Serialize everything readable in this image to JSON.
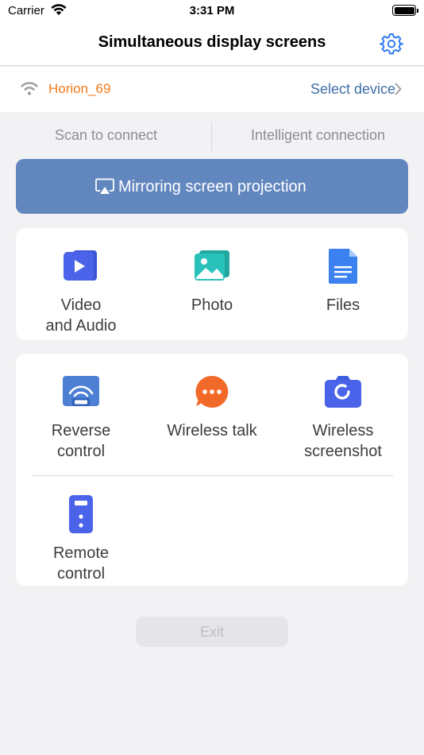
{
  "status_bar": {
    "carrier": "Carrier",
    "time": "3:31 PM"
  },
  "nav": {
    "title": "Simultaneous display screens"
  },
  "device": {
    "name": "Horion_69",
    "select_label": "Select device"
  },
  "tabs": [
    {
      "label": "Scan to connect"
    },
    {
      "label": "Intelligent connection"
    }
  ],
  "mirror": {
    "label": "Mirroring screen projection"
  },
  "media": [
    {
      "line1": "Video",
      "line2": "and Audio",
      "icon": "video-icon"
    },
    {
      "line1": "Photo",
      "line2": "",
      "icon": "photo-icon"
    },
    {
      "line1": "Files",
      "line2": "",
      "icon": "files-icon"
    }
  ],
  "tools": [
    {
      "line1": "Reverse",
      "line2": "control",
      "icon": "reverse-control-icon"
    },
    {
      "line1": "Wireless talk",
      "line2": "",
      "icon": "chat-bubble-icon"
    },
    {
      "line1": "Wireless",
      "line2": "screenshot",
      "icon": "camera-icon"
    },
    {
      "line1": "Remote",
      "line2": "control",
      "icon": "remote-icon"
    }
  ],
  "exit": {
    "label": "Exit"
  },
  "colors": {
    "accent": "#6287bf",
    "device_name": "#f27a1a",
    "link": "#3f6ea6",
    "icon_blue": "#4a63e8"
  }
}
